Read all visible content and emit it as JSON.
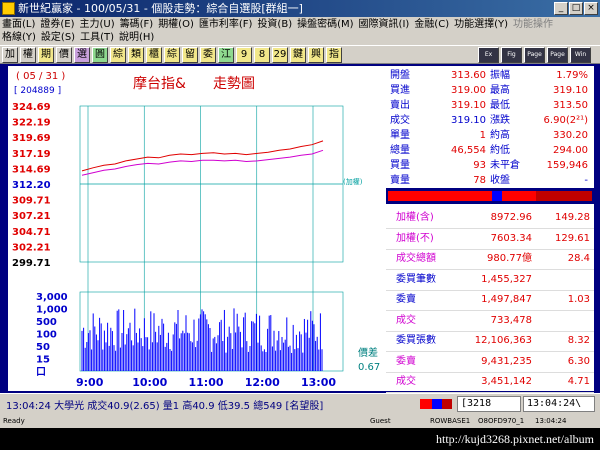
{
  "window": {
    "title": "新世紀贏家 - 100/05/31 - 個股走勢：綜合自選股[群組一]",
    "minimize": "_",
    "maximize": "□",
    "close": "×"
  },
  "menu": {
    "row1": [
      "畫面(L)",
      "證券(E)",
      "主力(U)",
      "籌碼(F)",
      "期權(O)",
      "匯市利率(F)",
      "投資(B)",
      "操盤密碼(M)",
      "國際資訊(I)",
      "金融(C)",
      "功能選擇(Y)"
    ],
    "row1_disabled": "功能操作",
    "row2": [
      "格線(Y)",
      "設定(S)",
      "工具(T)",
      "說明(H)"
    ]
  },
  "toolbar": [
    "加",
    "權",
    "期",
    "價",
    "選",
    "圓",
    "綜",
    "類",
    "櫃",
    "綜",
    "留",
    "委",
    "江",
    "9",
    "8",
    "29",
    "鍵",
    "興",
    "指"
  ],
  "toolbar_right": [
    "Ex",
    "Fig",
    "Page",
    "Page",
    "Win"
  ],
  "chart": {
    "date": "( 05 / 31 )",
    "volume_box": "[ 204889 ]",
    "title": "摩台指&",
    "title2": "走勢圖",
    "ref_label": "(加權)",
    "spread_label": "價差",
    "spread_value": "0.67"
  },
  "chart_data": {
    "type": "line",
    "price_ticks": [
      "324.69",
      "322.19",
      "319.69",
      "317.19",
      "314.69",
      "312.20",
      "309.71",
      "307.21",
      "304.71",
      "302.21",
      "299.71"
    ],
    "price_range": [
      299.71,
      324.69
    ],
    "reference_price": 312.2,
    "volume_ticks": [
      "3,000",
      "1,000",
      "500",
      "100",
      "50",
      "15",
      "口"
    ],
    "time_ticks": [
      "9:00",
      "10:00",
      "11:00",
      "12:00",
      "13:00"
    ],
    "series": [
      {
        "values": [
          314.3,
          314.8,
          315.2,
          315.4,
          315.9,
          316.2,
          316.5,
          316.4,
          316.8,
          317.0,
          316.9,
          317.1,
          317.2,
          317.0,
          317.1,
          316.9,
          317.1,
          317.3,
          317.6,
          317.8,
          318.2,
          318.5,
          319.1
        ]
      },
      {
        "values": [
          313.6,
          314.0,
          314.4,
          314.6,
          315.0,
          315.3,
          315.5,
          315.4,
          315.7,
          315.9,
          315.8,
          316.0,
          316.0,
          315.9,
          316.0,
          315.8,
          315.9,
          316.1,
          316.3,
          316.5,
          316.8,
          317.0,
          317.6
        ]
      }
    ],
    "grid": true
  },
  "quote": {
    "rows": [
      {
        "l1": "開盤",
        "v1": "313.60",
        "l2": "振幅",
        "v2": "1.79%"
      },
      {
        "l1": "買進",
        "v1": "319.00",
        "l2": "最高",
        "v2": "319.10"
      },
      {
        "l1": "賣出",
        "v1": "319.10",
        "l2": "最低",
        "v2": "313.50"
      },
      {
        "l1": "成交",
        "v1": "319.10",
        "l2": "漲跌",
        "v2": "6.90(2²¹)"
      },
      {
        "l1": "單量",
        "v1": "1",
        "l2": "約高",
        "v2": "330.20"
      },
      {
        "l1": "總量",
        "v1": "46,554",
        "l2": "約低",
        "v2": "294.00"
      },
      {
        "l1": "買量",
        "v1": "93",
        "l2": "未平倉",
        "v2": "159,946"
      },
      {
        "l1": "賣量",
        "v1": "78",
        "l2": "收盤",
        "v2": "-"
      }
    ]
  },
  "index": {
    "rows": [
      {
        "l": "加權(含)",
        "v1": "8972.96",
        "v2": "149.28"
      },
      {
        "l": "加權(不)",
        "v1": "7603.34",
        "v2": "129.61"
      },
      {
        "l": "成交總額",
        "v1": "980.77億",
        "v2": "28.4"
      },
      {
        "l": "委買筆數",
        "v1": "1,455,327",
        "v2": ""
      },
      {
        "l": "委賣",
        "v1": "1,497,847",
        "v2": "1.03"
      },
      {
        "l": "成交",
        "v1": "733,478",
        "v2": ""
      },
      {
        "l": "委買張數",
        "v1": "12,106,363",
        "v2": "8.32"
      },
      {
        "l": "委賣",
        "v1": "9,431,235",
        "v2": "6.30"
      },
      {
        "l": "成交",
        "v1": "3,451,142",
        "v2": "4.71"
      }
    ]
  },
  "ticker": {
    "text": "13:04:24 大學光 成交40.9(2.65) 量1 高40.9 低39.5 總549 [名望股]",
    "code": "[3218",
    "time": "13:04:24\\"
  },
  "status": {
    "left": "Ready",
    "guest": "Guest",
    "host": "ROWBASE1",
    "id": "O8OFD970_1",
    "time": "13:04:24"
  },
  "watermark": "http://kujd3268.pixnet.net/album",
  "colors": {
    "up": "#e00000",
    "down": "#008000",
    "blue": "#0000cc",
    "magenta": "#d000d0",
    "ref": "#00a0a0"
  }
}
